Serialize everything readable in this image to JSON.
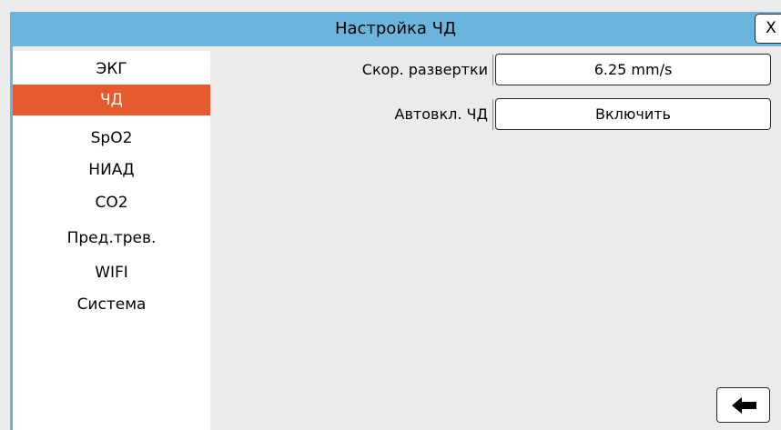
{
  "window": {
    "title": "Настройка ЧД",
    "close_label": "X"
  },
  "sidebar": {
    "items": [
      {
        "label": "ЭКГ",
        "active": false
      },
      {
        "label": "ЧД",
        "active": true
      },
      {
        "label": "SpO2",
        "active": false
      },
      {
        "label": "НИАД",
        "active": false
      },
      {
        "label": "CO2",
        "active": false
      },
      {
        "label": "Пред.трев.",
        "active": false
      },
      {
        "label": "WIFI",
        "active": false
      },
      {
        "label": "Система",
        "active": false
      }
    ]
  },
  "settings": [
    {
      "label": "Скор. развертки",
      "value": "6.25 mm/s"
    },
    {
      "label": "Автовкл. ЧД",
      "value": "Включить"
    }
  ],
  "footer": {
    "back_icon": "arrow-left-icon"
  },
  "colors": {
    "titlebar": "#6ab4dd",
    "active_item": "#e65a2e",
    "background": "#ebebeb"
  }
}
